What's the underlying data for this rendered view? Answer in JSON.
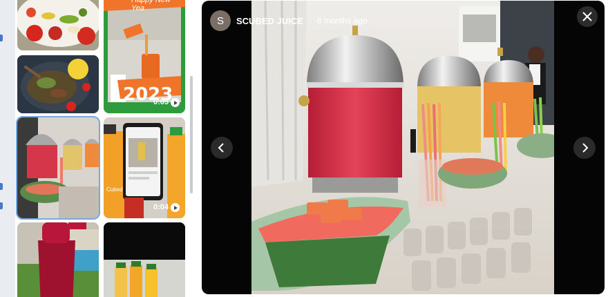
{
  "viewer": {
    "avatar_letter": "S",
    "channel_name": "SCUBED JUICE",
    "separator": "·",
    "posted_time": "8 months ago"
  },
  "grid": {
    "tiles": [
      {
        "id": "tile-fruit-platter",
        "type": "image"
      },
      {
        "id": "tile-new-year",
        "type": "video",
        "caption_top": "Happy New Yea",
        "caption": "2023",
        "duration": "0:05"
      },
      {
        "id": "tile-grilled-dish",
        "type": "image"
      },
      {
        "id": "tile-juice-dispensers",
        "type": "image",
        "selected": true
      },
      {
        "id": "tile-phone-juice",
        "type": "video",
        "duration": "0:04",
        "bottle_label": "Cubed"
      },
      {
        "id": "tile-red-juice-glass",
        "type": "image"
      },
      {
        "id": "tile-juice-bottles",
        "type": "image"
      }
    ]
  },
  "colors": {
    "viewer_bg": "#050505",
    "selected_outline": "#7aa7e0",
    "tile_green": "#2e9b3e",
    "tile_orange": "#f0742a"
  },
  "icons": [
    "close-icon",
    "chevron-left-icon",
    "chevron-right-icon",
    "play-icon"
  ]
}
